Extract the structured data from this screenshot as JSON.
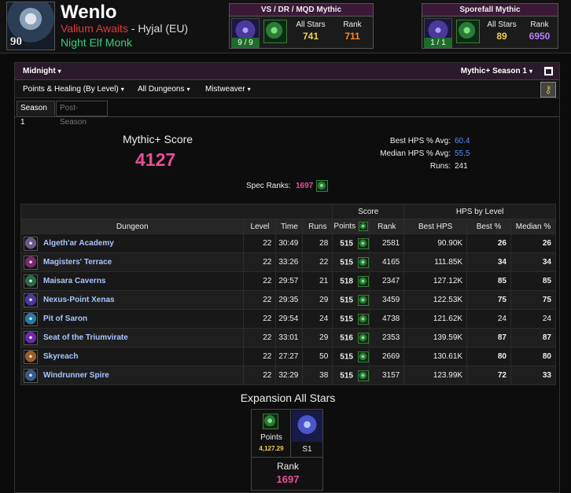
{
  "character": {
    "name": "Wenlo",
    "level": "90",
    "guild": "Valium Awaits",
    "separator": " - ",
    "realm": "Hyjal (EU)",
    "class_line": "Night Elf Monk"
  },
  "stat_boxes": [
    {
      "title": "VS / DR / MQD Mythic",
      "progress": "9 / 9",
      "allstars_label": "All Stars",
      "allstars": "741",
      "rank_label": "Rank",
      "rank": "711"
    },
    {
      "title": "Sporefall Mythic",
      "progress": "1 / 1",
      "allstars_label": "All Stars",
      "allstars": "89",
      "rank_label": "Rank",
      "rank": "6950"
    }
  ],
  "topbar": {
    "zone": "Midnight",
    "season": "Mythic+ Season 1"
  },
  "filters": {
    "metric": "Points & Healing (By Level)",
    "dungeons": "All Dungeons",
    "spec": "Mistweaver"
  },
  "caret": "▾",
  "key_icon": "⚷",
  "season_tabs": [
    "Season 1",
    "Post-Season"
  ],
  "summary": {
    "score_label": "Mythic+ Score",
    "score": "4127",
    "best_avg_label": "Best HPS % Avg:",
    "best_avg": "60.4",
    "median_avg_label": "Median HPS % Avg:",
    "median_avg": "55.5",
    "runs_label": "Runs:",
    "runs": "241",
    "spec_ranks_label": "Spec Ranks:",
    "spec_ranks": "1697"
  },
  "table": {
    "group_headers": {
      "score": "Score",
      "hps": "HPS by Level"
    },
    "columns": [
      "Dungeon",
      "Level",
      "Time",
      "Runs",
      "Points",
      "Rank",
      "Best HPS",
      "Best %",
      "Median %"
    ],
    "rows": [
      {
        "dungeon": "Algeth'ar Academy",
        "level": "22",
        "time": "30:49",
        "runs": "28",
        "points": "515",
        "rank": "2581",
        "best_hps": "90.90K",
        "best_pct": "26",
        "best_cls": "green",
        "median_pct": "26",
        "median_cls": "green",
        "icon": "#6a5a8a"
      },
      {
        "dungeon": "Magisters' Terrace",
        "level": "22",
        "time": "33:26",
        "runs": "22",
        "points": "515",
        "rank": "4165",
        "best_hps": "111.85K",
        "best_pct": "34",
        "best_cls": "green",
        "median_pct": "34",
        "median_cls": "green",
        "icon": "#7a2a6a"
      },
      {
        "dungeon": "Maisara Caverns",
        "level": "22",
        "time": "29:57",
        "runs": "21",
        "points": "518",
        "rank": "2347",
        "best_hps": "127.12K",
        "best_pct": "85",
        "best_cls": "purple",
        "median_pct": "85",
        "median_cls": "purple",
        "icon": "#2a6a4a"
      },
      {
        "dungeon": "Nexus-Point Xenas",
        "level": "22",
        "time": "29:35",
        "runs": "29",
        "points": "515",
        "rank": "3459",
        "best_hps": "122.53K",
        "best_pct": "75",
        "best_cls": "purple",
        "median_pct": "75",
        "median_cls": "purple",
        "icon": "#4a3aa0"
      },
      {
        "dungeon": "Pit of Saron",
        "level": "22",
        "time": "29:54",
        "runs": "24",
        "points": "515",
        "rank": "4738",
        "best_hps": "121.62K",
        "best_pct": "24",
        "best_cls": "grey",
        "median_pct": "24",
        "median_cls": "grey",
        "icon": "#2a7aa0"
      },
      {
        "dungeon": "Seat of the Triumvirate",
        "level": "22",
        "time": "33:01",
        "runs": "29",
        "points": "516",
        "rank": "2353",
        "best_hps": "139.59K",
        "best_pct": "87",
        "best_cls": "purple",
        "median_pct": "87",
        "median_cls": "purple",
        "icon": "#6a2ab0"
      },
      {
        "dungeon": "Skyreach",
        "level": "22",
        "time": "27:27",
        "runs": "50",
        "points": "515",
        "rank": "2669",
        "best_hps": "130.61K",
        "best_pct": "80",
        "best_cls": "purple",
        "median_pct": "80",
        "median_cls": "purple",
        "icon": "#9a5a2a"
      },
      {
        "dungeon": "Windrunner Spire",
        "level": "22",
        "time": "32:29",
        "runs": "38",
        "points": "515",
        "rank": "3157",
        "best_hps": "123.99K",
        "best_pct": "72",
        "best_cls": "bluepct",
        "median_pct": "33",
        "median_cls": "green",
        "icon": "#3a5a8a"
      }
    ]
  },
  "expansion": {
    "title": "Expansion All Stars",
    "points_label": "Points",
    "points": "4,127.29",
    "season_label": "S1",
    "rank_label": "Rank",
    "rank": "1697"
  }
}
